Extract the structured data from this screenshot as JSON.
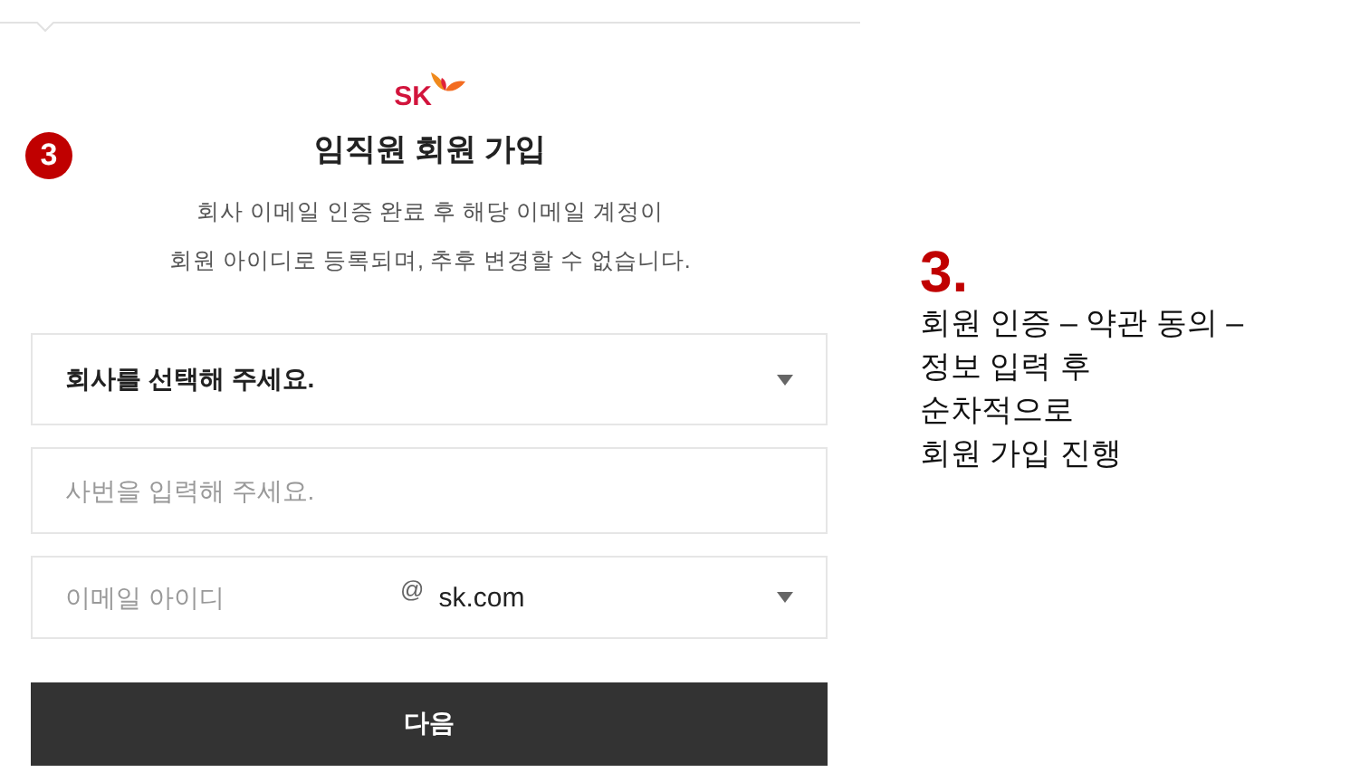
{
  "step_badge": "3",
  "logo": {
    "text": "SK"
  },
  "title": "임직원 회원 가입",
  "description": [
    "회사 이메일 인증 완료 후 해당 이메일 계정이",
    "회원 아이디로 등록되며, 추후 변경할 수 없습니다."
  ],
  "company_select": {
    "value": "회사를 선택해 주세요."
  },
  "employee_id": {
    "placeholder": "사번을 입력해 주세요."
  },
  "email": {
    "placeholder": "이메일 아이디",
    "at": "@",
    "domain": "sk.com"
  },
  "next_button": "다음",
  "note": {
    "heading": "3.",
    "lines": [
      "회원 인증 – 약관 동의 –",
      "정보 입력 후",
      "순차적으로",
      "회원 가입 진행"
    ]
  }
}
